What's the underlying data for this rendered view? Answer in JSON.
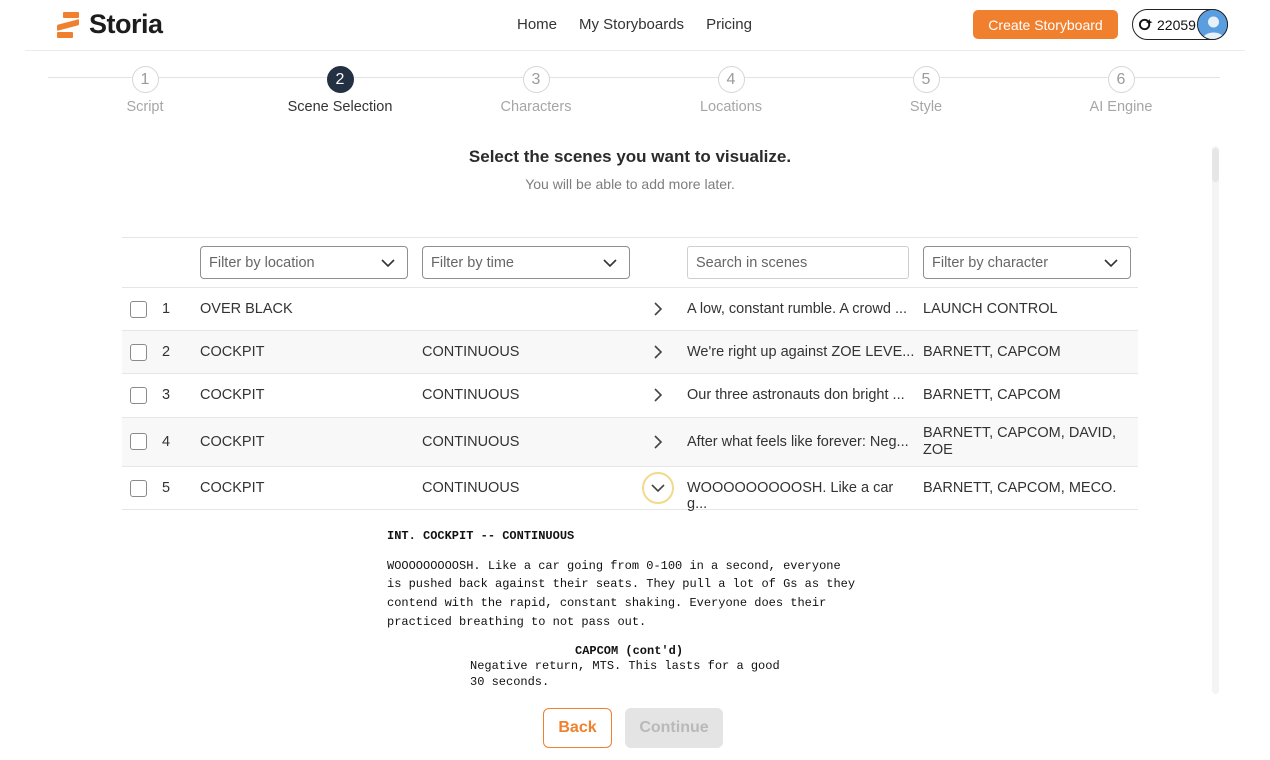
{
  "brand": {
    "name": "Storia",
    "accent": "#f0802e",
    "dark": "#243142"
  },
  "nav": {
    "home": "Home",
    "storyboards": "My Storyboards",
    "pricing": "Pricing"
  },
  "header": {
    "create_label": "Create Storyboard",
    "credits": "22059",
    "credits_icon": "sparkle-coin-icon",
    "avatar_icon": "user-avatar-icon"
  },
  "steps": [
    {
      "num": "1",
      "label": "Script"
    },
    {
      "num": "2",
      "label": "Scene Selection"
    },
    {
      "num": "3",
      "label": "Characters"
    },
    {
      "num": "4",
      "label": "Locations"
    },
    {
      "num": "5",
      "label": "Style"
    },
    {
      "num": "6",
      "label": "AI Engine"
    }
  ],
  "page": {
    "title": "Select the scenes you want to visualize.",
    "subtitle": "You will be able to add more later."
  },
  "filters": {
    "location": "Filter by location",
    "time": "Filter by time",
    "search_placeholder": "Search in scenes",
    "character": "Filter by character"
  },
  "scenes": [
    {
      "num": "1",
      "location": "OVER BLACK",
      "time": "",
      "summary": "A low, constant rumble. A crowd ...",
      "characters": "LAUNCH CONTROL",
      "checked": false
    },
    {
      "num": "2",
      "location": "COCKPIT",
      "time": "CONTINUOUS",
      "summary": "We're right up against ZOE LEVE...",
      "characters": "BARNETT, CAPCOM",
      "checked": false
    },
    {
      "num": "3",
      "location": "COCKPIT",
      "time": "CONTINUOUS",
      "summary": "Our three astronauts don bright ...",
      "characters": "BARNETT, CAPCOM",
      "checked": false
    },
    {
      "num": "4",
      "location": "COCKPIT",
      "time": "CONTINUOUS",
      "summary": "After what feels like forever: Neg...",
      "characters": "BARNETT, CAPCOM, DAVID, ZOE",
      "checked": false
    },
    {
      "num": "5",
      "location": "COCKPIT",
      "time": "CONTINUOUS",
      "summary": "WOOOOOOOOOSH. Like a car g...",
      "characters": "BARNETT, CAPCOM, MECO.",
      "checked": false
    }
  ],
  "script": {
    "scene_heading": "INT. COCKPIT -- CONTINUOUS",
    "action": [
      "WOOOOOOOOOSH. Like a car going from 0-100 in a second, everyone",
      "is pushed back against their seats. They pull a lot of Gs as they",
      "contend with the rapid, constant shaking. Everyone does their",
      "practiced breathing to not pass out."
    ],
    "character": "CAPCOM (cont'd)",
    "dialogue": [
      "Negative return, MTS. This lasts for a good",
      "30 seconds."
    ]
  },
  "actions": {
    "back": "Back",
    "continue": "Continue"
  }
}
